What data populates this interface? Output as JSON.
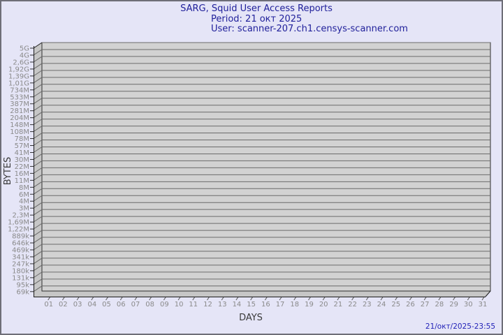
{
  "title": {
    "line1": "SARG, Squid User Access Reports",
    "line2": "Period: 21 окт 2025",
    "line3": "User: scanner-207.ch1.censys-scanner.com"
  },
  "footer": {
    "timestamp": "21/окт/2025-23:55"
  },
  "chart_data": {
    "type": "bar",
    "title": "SARG, Squid User Access Reports",
    "subtitle": "Period: 21 окт 2025",
    "user": "scanner-207.ch1.censys-scanner.com",
    "xlabel": "DAYS",
    "ylabel": "BYTES",
    "scale": "logarithmic",
    "grid": true,
    "legend": "none",
    "y_axis_range_labels": [
      "69k",
      "5G"
    ],
    "y_tick_labels": [
      "5G",
      "4G",
      "2,6G",
      "1,92G",
      "1,39G",
      "1,01G",
      "734M",
      "533M",
      "387M",
      "281M",
      "204M",
      "148M",
      "108M",
      "78M",
      "57M",
      "41M",
      "30M",
      "22M",
      "16M",
      "11M",
      "8M",
      "6M",
      "4M",
      "3M",
      "2,3M",
      "1,69M",
      "1,22M",
      "889k",
      "646k",
      "469k",
      "341k",
      "247k",
      "180k",
      "131k",
      "95k",
      "69k"
    ],
    "categories": [
      "01",
      "02",
      "03",
      "04",
      "05",
      "06",
      "07",
      "08",
      "09",
      "10",
      "11",
      "12",
      "13",
      "14",
      "15",
      "16",
      "17",
      "18",
      "19",
      "20",
      "21",
      "22",
      "23",
      "24",
      "25",
      "26",
      "27",
      "28",
      "29",
      "30",
      "31"
    ],
    "values": [
      0,
      0,
      0,
      0,
      0,
      0,
      0,
      0,
      0,
      0,
      0,
      0,
      0,
      0,
      0,
      0,
      0,
      0,
      0,
      0,
      0,
      0,
      0,
      0,
      0,
      0,
      0,
      0,
      0,
      0,
      0
    ],
    "note": "empty plot area - no bars rendered for any day"
  },
  "colors": {
    "background": "#e5e5f7",
    "page_border": "#6e6e78",
    "title_text": "#21219b",
    "plot_face": "#d2d2d2",
    "plot_side": "#c6c6c6",
    "gridline": "#6b6b6b",
    "axis_line": "#1a1a1a",
    "face_border": "#2f2f2f",
    "tick_label": "#8a8a8a",
    "axis_label": "#3a3a3a",
    "timestamp_text": "#2222b8"
  }
}
